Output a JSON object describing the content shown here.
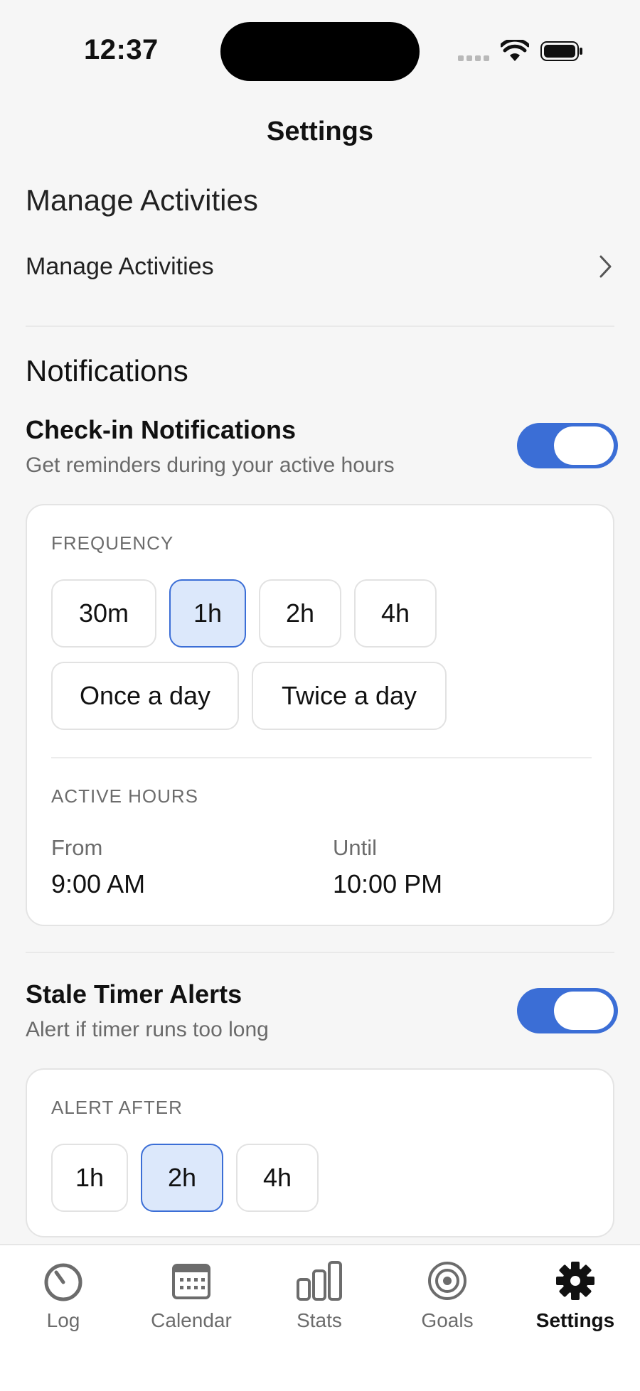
{
  "status_bar": {
    "time": "12:37"
  },
  "nav": {
    "title": "Settings"
  },
  "manage_section": {
    "title": "Manage Activities",
    "row_label": "Manage Activities"
  },
  "notifications_section": {
    "title": "Notifications",
    "checkin": {
      "title": "Check-in Notifications",
      "subtitle": "Get reminders during your active hours",
      "enabled": true
    },
    "frequency": {
      "caption": "FREQUENCY",
      "options": [
        "30m",
        "1h",
        "2h",
        "4h",
        "Once a day",
        "Twice a day"
      ],
      "selected": "1h"
    },
    "active_hours": {
      "caption": "ACTIVE HOURS",
      "from_label": "From",
      "from_value": "9:00 AM",
      "until_label": "Until",
      "until_value": "10:00 PM"
    },
    "stale": {
      "title": "Stale Timer Alerts",
      "subtitle": "Alert if timer runs too long",
      "enabled": true
    },
    "alert_after": {
      "caption": "ALERT AFTER",
      "options": [
        "1h",
        "2h",
        "4h"
      ],
      "selected": "2h"
    }
  },
  "tab_bar": {
    "tabs": [
      {
        "label": "Log",
        "icon": "timer-icon"
      },
      {
        "label": "Calendar",
        "icon": "calendar-icon"
      },
      {
        "label": "Stats",
        "icon": "bar-chart-icon"
      },
      {
        "label": "Goals",
        "icon": "target-icon"
      },
      {
        "label": "Settings",
        "icon": "gear-icon"
      }
    ],
    "active": "Settings"
  },
  "colors": {
    "accent": "#3b6ed6",
    "selected_bg": "#dce8fb",
    "background": "#f6f6f6"
  }
}
